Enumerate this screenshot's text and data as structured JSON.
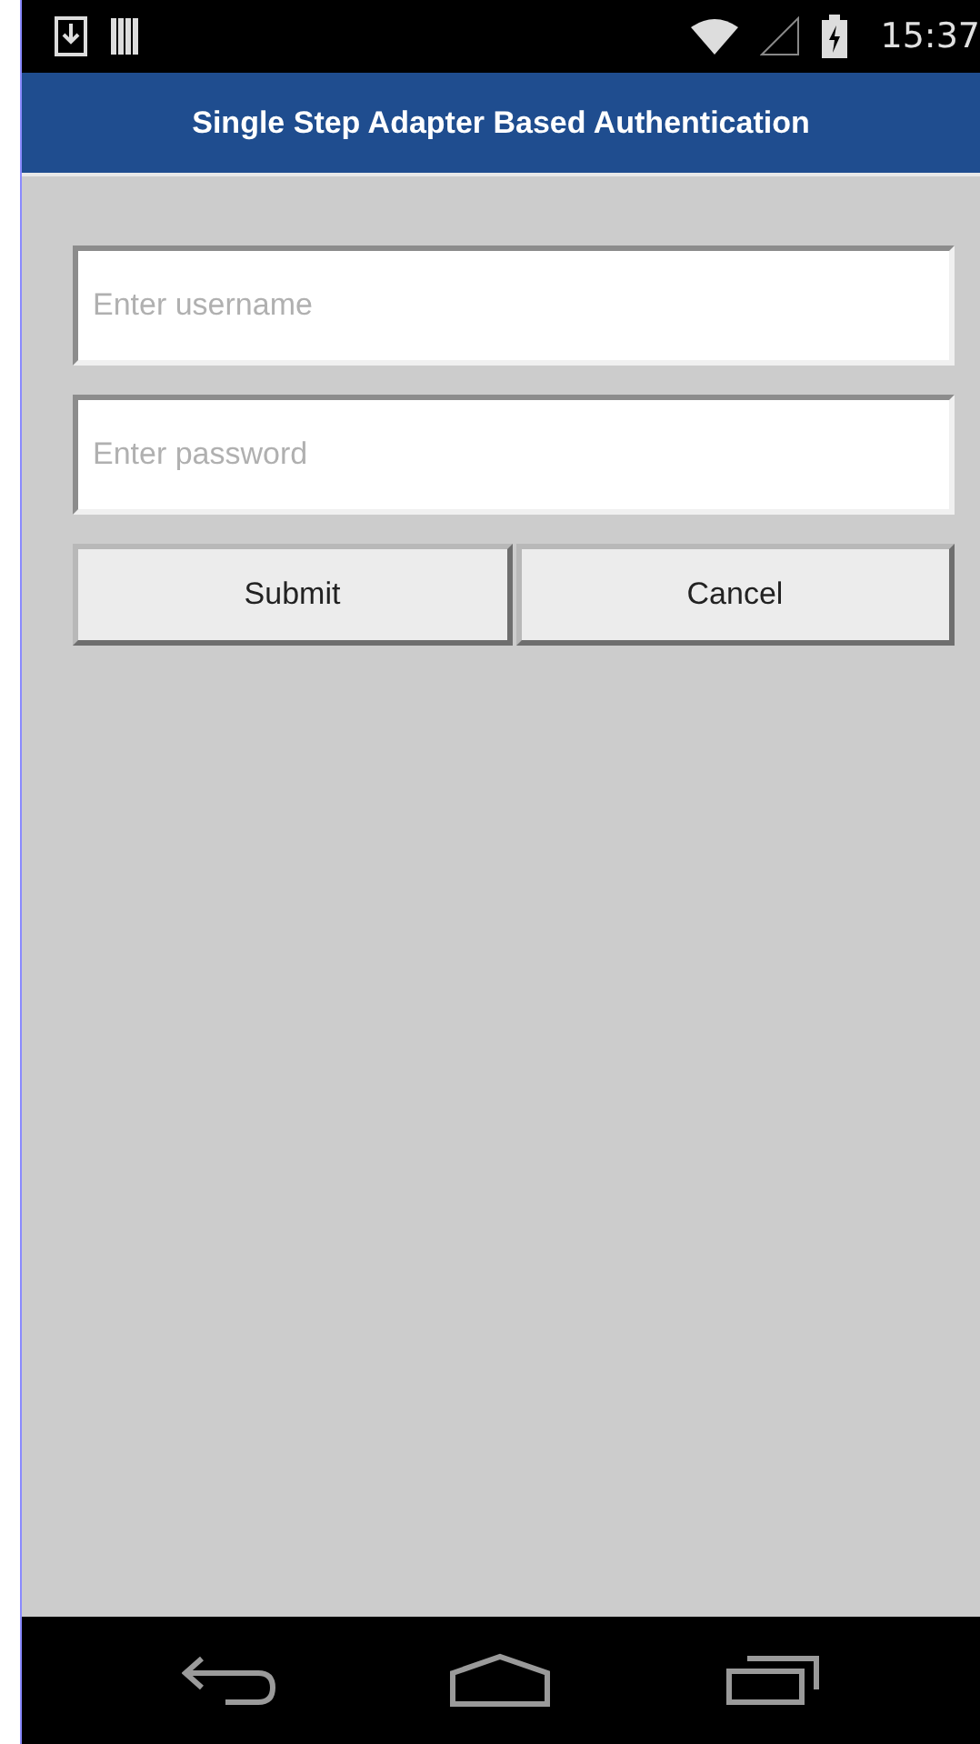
{
  "status_bar": {
    "time": "15:37"
  },
  "title_bar": {
    "title": "Single Step Adapter Based Authentication"
  },
  "form": {
    "fields": [
      {
        "placeholder": "Enter username"
      },
      {
        "placeholder": "Enter password"
      }
    ],
    "buttons": [
      "Submit",
      "Cancel"
    ]
  }
}
